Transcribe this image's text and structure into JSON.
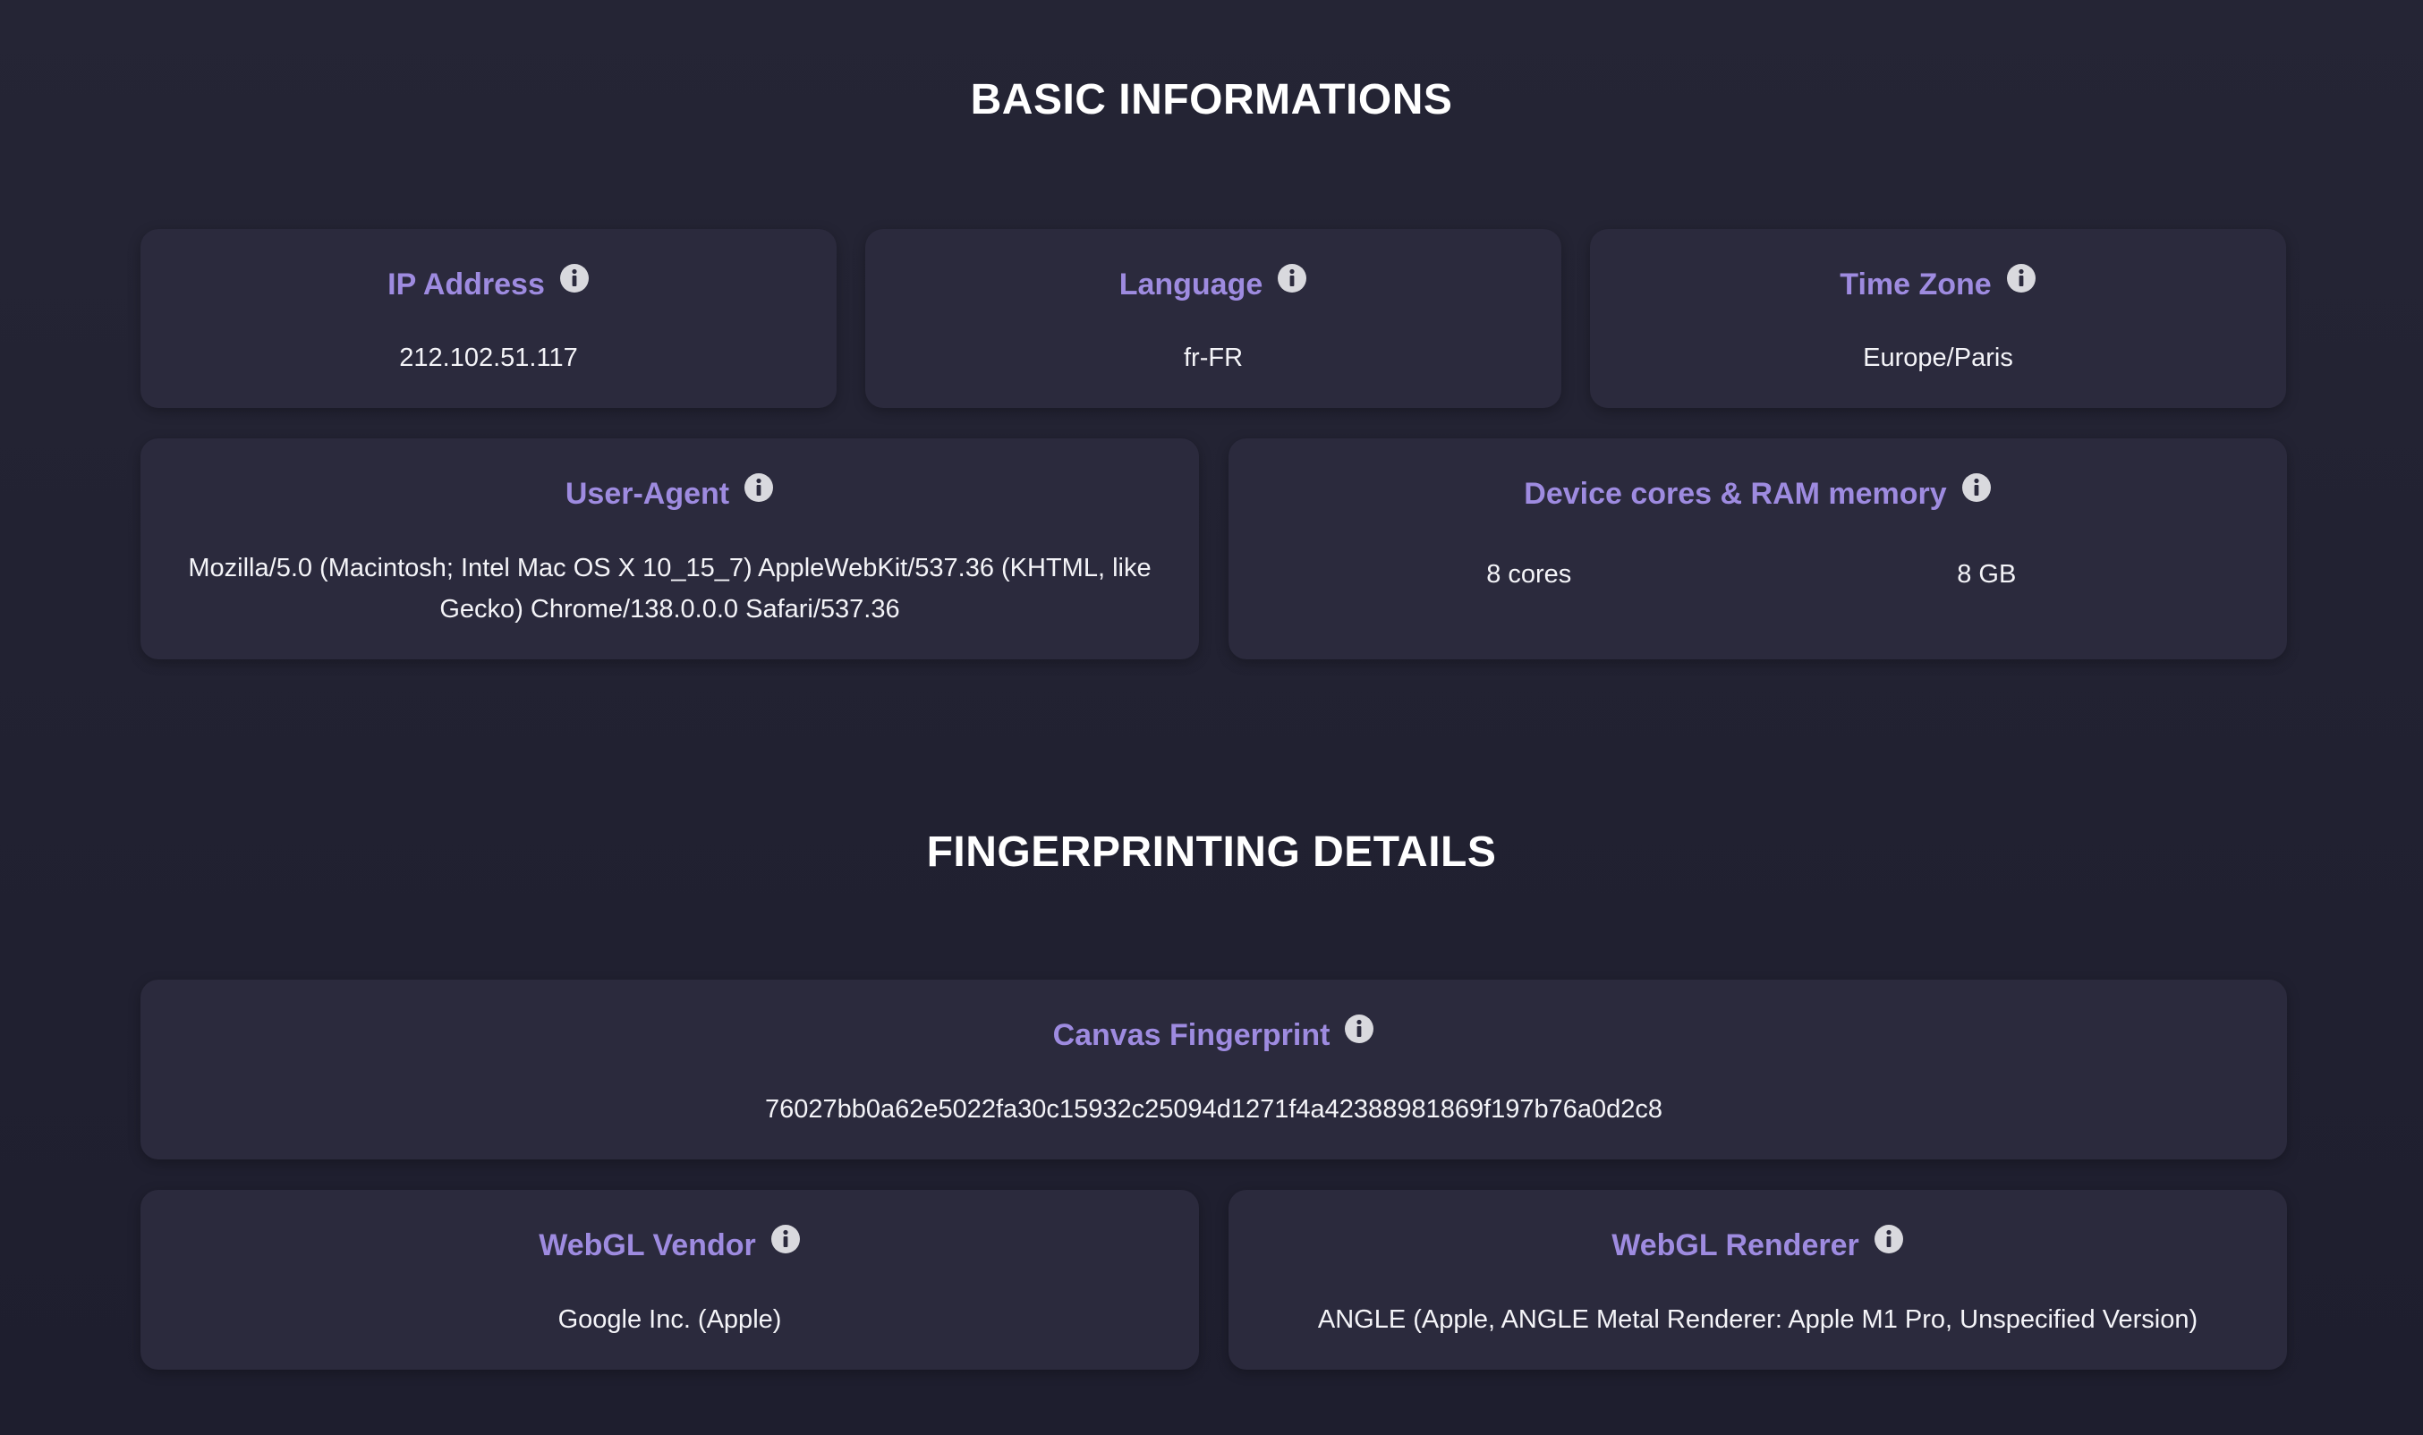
{
  "sections": {
    "basic_title": "BASIC INFORMATIONS",
    "fingerprint_title": "FINGERPRINTING DETAILS"
  },
  "cards": {
    "ip": {
      "label": "IP Address",
      "value": "212.102.51.117",
      "icon": "info-icon"
    },
    "language": {
      "label": "Language",
      "value": "fr-FR",
      "icon": "info-icon"
    },
    "timezone": {
      "label": "Time Zone",
      "value": "Europe/Paris",
      "icon": "info-icon"
    },
    "user_agent": {
      "label": "User-Agent",
      "value": "Mozilla/5.0 (Macintosh; Intel Mac OS X 10_15_7) AppleWebKit/537.36 (KHTML, like Gecko) Chrome/138.0.0.0 Safari/537.36",
      "icon": "info-icon"
    },
    "device": {
      "label": "Device cores & RAM memory",
      "cores": "8 cores",
      "ram": "8 GB",
      "icon": "info-icon"
    },
    "canvas": {
      "label": "Canvas Fingerprint",
      "value": "76027bb0a62e5022fa30c15932c25094d1271f4a42388981869f197b76a0d2c8",
      "icon": "info-icon"
    },
    "webgl_vendor": {
      "label": "WebGL Vendor",
      "value": "Google Inc. (Apple)",
      "icon": "info-icon"
    },
    "webgl_renderer": {
      "label": "WebGL Renderer",
      "value": "ANGLE (Apple, ANGLE Metal Renderer: Apple M1 Pro, Unspecified Version)",
      "icon": "info-icon"
    }
  },
  "colors": {
    "background": "#202030",
    "card": "#2b2a3d",
    "label": "#9e8be0",
    "text": "#f4f4f8",
    "icon": "#d9d9de"
  }
}
